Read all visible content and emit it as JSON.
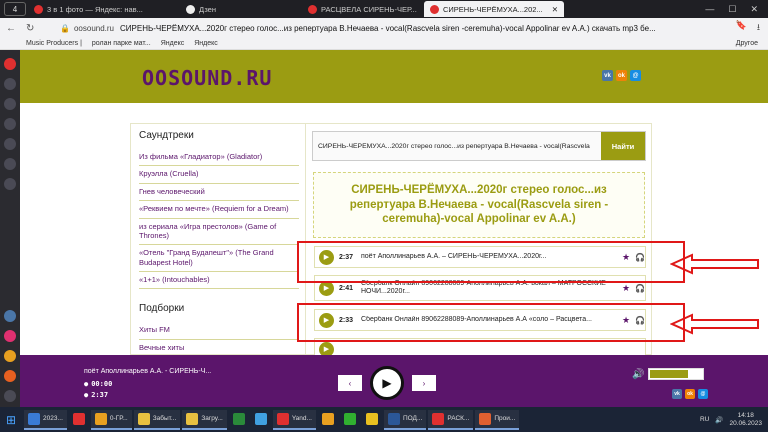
{
  "browser": {
    "tab_count": "4",
    "tabs": [
      {
        "label": "3 в 1 фото — Яндекс: нав...",
        "color": "#e03030"
      },
      {
        "label": "Дзен",
        "color": "#222222"
      },
      {
        "label": "РАСЦВЕЛА СИРЕНЬ-ЧЕР...",
        "color": "#e03030"
      },
      {
        "label": "СИРЕНЬ-ЧЕРЁМУХА...202...",
        "color": "#e03030",
        "active": true
      }
    ],
    "url": "oosound.ru",
    "page_title": "СИРЕНЬ-ЧЕРЁМУХА...2020г стерео голос...из репертуара В.Нечаева - vocal(Rascvela siren -ceremuha)-vocal Appolinar ev A.A.) скачать mp3 бе...",
    "bookmarks": [
      "Music Producers |",
      "ролан парке мат...",
      "Яндекс",
      "Яндекс"
    ],
    "bookmarks_more": "Другое"
  },
  "site": {
    "logo": "OOSOUND.RU",
    "social": [
      "vk",
      "ok",
      "mm"
    ]
  },
  "sidebar": {
    "section1_title": "Саундтреки",
    "section1_items": [
      "Из фильма «Гладиатор» (Gladiator)",
      "Круэлла (Cruella)",
      "Гнев человеческий",
      "«Реквием по мечте» (Requiem for a Dream)",
      "из сериала «Игра престолов» (Game of Thrones)",
      "«Отель \"Гранд Будапешт\"» (The Grand Budapest Hotel)",
      "«1+1» (Intouchables)"
    ],
    "section2_title": "Подборки",
    "section2_items": [
      "Хиты FM",
      "Вечные хиты"
    ]
  },
  "search": {
    "value": "СИРЕНЬ-ЧЕРЁМУХА...2020г стерео голос...из репертуара В.Нечаева - vocal(Rascvela",
    "button": "Найти"
  },
  "song": {
    "title": "СИРЕНЬ-ЧЕРЁМУХА...2020г стерео голос...из репертуара В.Нечаева - vocal(Rascvela siren - ceremuha)-vocal Appolinar ev A.A.)"
  },
  "tracks": [
    {
      "duration": "2:37",
      "text": "поёт Аполлинарьев А.А. – СИРЕНЬ-ЧЕРЁМУХА...2020г..."
    },
    {
      "duration": "2:41",
      "text": "Сбербанк Онлайн 89062288089-Аполлинарьев А.А.-вокал – МАТРОССКИЕ НОЧИ...2020г..."
    },
    {
      "duration": "2:33",
      "text": "Сбербанк Онлайн 89062288089-Аполлинарьев А.А «соло – Расцвета..."
    }
  ],
  "player": {
    "now_playing": "поёт Аполлинарьев А.А. - СИРЕНЬ-Ч...",
    "elapsed": "00:00",
    "total": "2:37",
    "volume": 0.72,
    "prev": "‹",
    "next": "›"
  },
  "taskbar": {
    "items": [
      {
        "label": "2023...",
        "color": "#3a7bd5"
      },
      {
        "label": "",
        "color": "#e03030"
      },
      {
        "label": "0-ГР...",
        "color": "#e8a020"
      },
      {
        "label": "Забыт...",
        "color": "#e8c040"
      },
      {
        "label": "Загру...",
        "color": "#e8c040"
      },
      {
        "label": "",
        "color": "#2a8a3a"
      },
      {
        "label": "",
        "color": "#40a0e0"
      },
      {
        "label": "Yand...",
        "color": "#e03030"
      },
      {
        "label": "",
        "color": "#e8a020"
      },
      {
        "label": "",
        "color": "#30b030"
      },
      {
        "label": "",
        "color": "#e8c020"
      },
      {
        "label": "ПОД...",
        "color": "#2b5797"
      },
      {
        "label": "РАСК...",
        "color": "#e03030"
      },
      {
        "label": "Прои...",
        "color": "#e06030"
      }
    ],
    "lang": "RU",
    "time": "14:18",
    "date": "20.06.2023"
  }
}
